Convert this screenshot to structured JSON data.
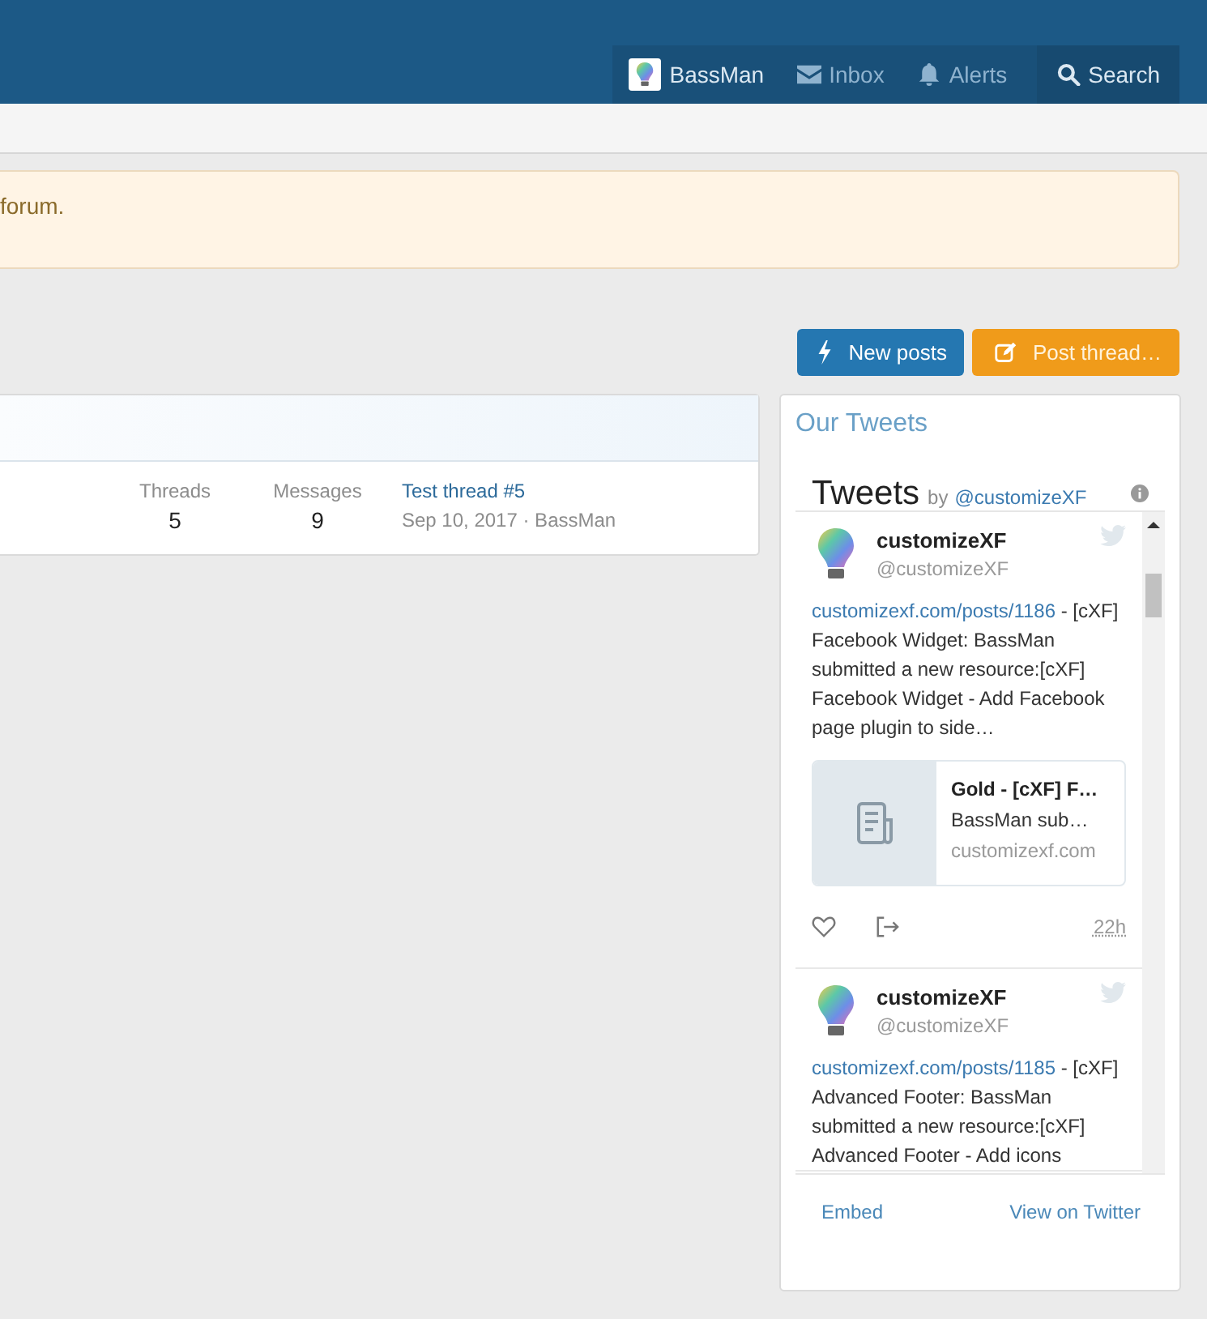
{
  "header": {
    "nav": [
      {
        "kind": "user",
        "label": "BassMan"
      },
      {
        "kind": "inbox",
        "label": "Inbox"
      },
      {
        "kind": "alerts",
        "label": "Alerts"
      },
      {
        "kind": "search",
        "label": "Search"
      }
    ]
  },
  "notice": {
    "text": "forum."
  },
  "buttons": [
    {
      "kind": "new",
      "label": "New posts"
    },
    {
      "kind": "post",
      "label": "Post thread…"
    }
  ],
  "forum_row": {
    "stats": [
      {
        "label": "Threads",
        "value": "5"
      },
      {
        "label": "Messages",
        "value": "9"
      }
    ],
    "last_post": {
      "title": "Test thread #5",
      "meta": "Sep 10, 2017 · BassMan"
    }
  },
  "widget": {
    "title": "Our Tweets",
    "timeline": {
      "title": "Tweets",
      "by": "by",
      "handle": "@customizeXF"
    },
    "tweets": [
      {
        "name": "customizeXF",
        "handle": "@customizeXF",
        "link": "customizexf.com/posts/1186",
        "text": " - [cXF] Facebook Widget: BassMan submitted a new resource:[cXF] Facebook Widget - Add Facebook page plugin to side…",
        "card": {
          "title": "Gold - [cXF] F…",
          "summary": "BassMan sub…",
          "domain": "customizexf.com"
        },
        "time": "22h"
      },
      {
        "name": "customizeXF",
        "handle": "@customizeXF",
        "link": "customizexf.com/posts/1185",
        "text": " - [cXF] Advanced Footer: BassMan submitted a new resource:[cXF] Advanced Footer - Add icons"
      }
    ],
    "footer": {
      "embed": "Embed",
      "view": "View on Twitter"
    }
  }
}
